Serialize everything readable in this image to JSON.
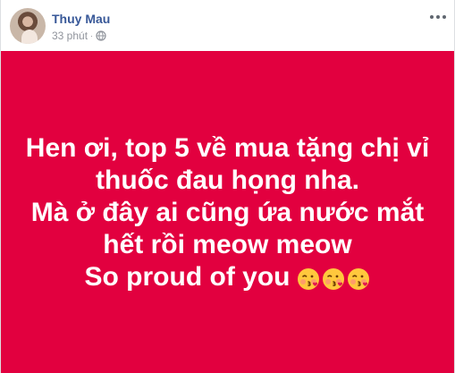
{
  "post": {
    "author": "Thuy Mau",
    "timestamp": "33 phút",
    "privacy_icon": "globe-icon",
    "more_icon": "ellipsis-icon"
  },
  "status": {
    "background_color": "#e2003f",
    "text_color": "#ffffff",
    "lines": [
      "Hen ơi, top 5 về mua tặng chị vỉ",
      "thuốc đau họng nha.",
      "Mà ở đây ai cũng ứa nước mắt",
      "hết rồi meow meow",
      "So proud of you"
    ],
    "emoji_icons": [
      "kissing-face-emoji",
      "kissing-face-emoji",
      "kissing-face-emoji"
    ]
  }
}
